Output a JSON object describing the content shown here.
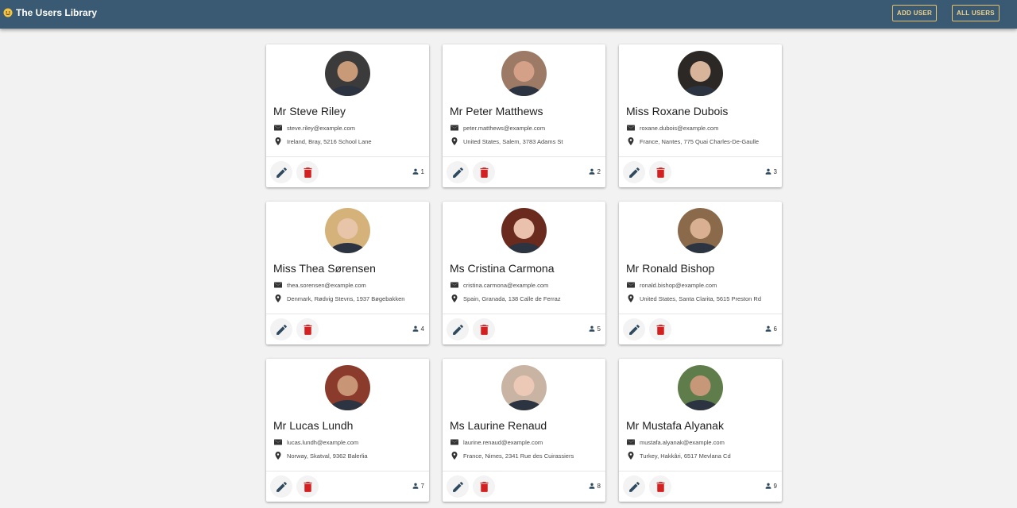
{
  "app": {
    "title": "The Users Library",
    "accent": "#3a5a73",
    "button_accent": "#e6c26a"
  },
  "nav": {
    "add_user": "ADD USER",
    "all_users": "ALL USERS"
  },
  "icons": {
    "brand": "smiley-icon",
    "email": "envelope-icon",
    "location": "map-pin-icon",
    "edit": "pencil-icon",
    "delete": "trash-icon",
    "id": "person-icon"
  },
  "users": [
    {
      "name": "Mr Steve Riley",
      "email": "steve.riley@example.com",
      "location": "Ireland, Bray, 5216 School Lane",
      "id": "1",
      "avatar_bg": "#3b3b3b",
      "avatar_skin": "#c99a78"
    },
    {
      "name": "Mr Peter Matthews",
      "email": "peter.matthews@example.com",
      "location": "United States, Salem, 3783 Adams St",
      "id": "2",
      "avatar_bg": "#9c7a66",
      "avatar_skin": "#d4a088"
    },
    {
      "name": "Miss Roxane Dubois",
      "email": "roxane.dubois@example.com",
      "location": "France, Nantes, 775 Quai Charles-De-Gaulle",
      "id": "3",
      "avatar_bg": "#2c2825",
      "avatar_skin": "#d8b49a"
    },
    {
      "name": "Miss Thea Sørensen",
      "email": "thea.sorensen@example.com",
      "location": "Denmark, Rødvig Stevns, 1937 Bøgebakken",
      "id": "4",
      "avatar_bg": "#d4b27a",
      "avatar_skin": "#e8c4a8"
    },
    {
      "name": "Ms Cristina Carmona",
      "email": "cristina.carmona@example.com",
      "location": "Spain, Granada, 138 Calle de Ferraz",
      "id": "5",
      "avatar_bg": "#6b2a1e",
      "avatar_skin": "#e9c1ad"
    },
    {
      "name": "Mr Ronald Bishop",
      "email": "ronald.bishop@example.com",
      "location": "United States, Santa Clarita, 5615 Preston Rd",
      "id": "6",
      "avatar_bg": "#8a6a4a",
      "avatar_skin": "#d9b091"
    },
    {
      "name": "Mr Lucas Lundh",
      "email": "lucas.lundh@example.com",
      "location": "Norway, Skatval, 9362 Balerlia",
      "id": "7",
      "avatar_bg": "#8a3b2c",
      "avatar_skin": "#c99577"
    },
    {
      "name": "Ms Laurine Renaud",
      "email": "laurine.renaud@example.com",
      "location": "France, Nimes, 2341 Rue des Cuirassiers",
      "id": "8",
      "avatar_bg": "#c9b4a4",
      "avatar_skin": "#ecc9b6"
    },
    {
      "name": "Mr Mustafa Alyanak",
      "email": "mustafa.alyanak@example.com",
      "location": "Turkey, Hakkâri, 6517 Mevlana Cd",
      "id": "9",
      "avatar_bg": "#5f7d4a",
      "avatar_skin": "#c7977a"
    }
  ]
}
